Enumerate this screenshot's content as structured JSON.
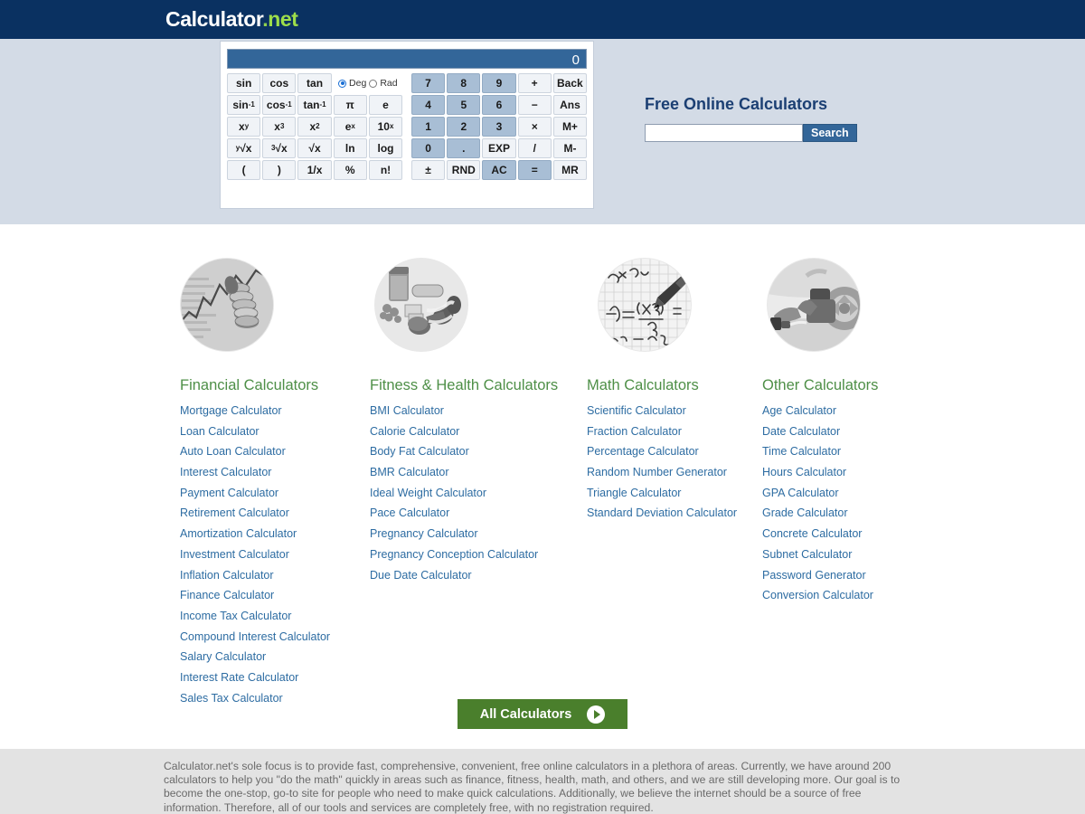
{
  "header": {
    "logo_word": "Calculator",
    "logo_dot": ".",
    "logo_tld": "net",
    "bg_color": "#0a3161"
  },
  "hero": {
    "bg_color": "#d3dbe6",
    "title": "Free Online Calculators",
    "search": {
      "value": "",
      "placeholder": "",
      "button_label": "Search"
    }
  },
  "calculator": {
    "display_value": "0",
    "angle_mode": {
      "selected": "Deg",
      "options": [
        "Deg",
        "Rad"
      ]
    },
    "rows": [
      {
        "left": [
          "sin",
          "cos",
          "tan"
        ],
        "mode_widget": true,
        "right": [
          "7",
          "8",
          "9",
          "+",
          "Back"
        ]
      },
      {
        "left": [
          "sin⁻¹",
          "cos⁻¹",
          "tan⁻¹",
          "π",
          "e"
        ],
        "right": [
          "4",
          "5",
          "6",
          "−",
          "Ans"
        ]
      },
      {
        "left": [
          "xʸ",
          "x³",
          "x²",
          "eˣ",
          "10ˣ"
        ],
        "right": [
          "1",
          "2",
          "3",
          "×",
          "M+"
        ]
      },
      {
        "left": [
          "ʸ√x",
          "³√x",
          "√x",
          "ln",
          "log"
        ],
        "right": [
          "0",
          ".",
          "EXP",
          "/",
          "M-"
        ]
      },
      {
        "left": [
          "(",
          ")",
          "1/x",
          "%",
          "n!"
        ],
        "right": [
          "±",
          "RND",
          "AC",
          "=",
          "MR"
        ]
      }
    ],
    "accent_keys": [
      "7",
      "8",
      "9",
      "4",
      "5",
      "6",
      "1",
      "2",
      "3",
      "0",
      ".",
      "AC",
      "="
    ],
    "display_bg": "#336699",
    "key_bg": "#f0f3f7",
    "key_accent_bg": "#a8bed5"
  },
  "categories": [
    {
      "thumb_icon": "coins-chart-icon",
      "title": "Financial Calculators",
      "links": [
        "Mortgage Calculator",
        "Loan Calculator",
        "Auto Loan Calculator",
        "Interest Calculator",
        "Payment Calculator",
        "Retirement Calculator",
        "Amortization Calculator",
        "Investment Calculator",
        "Inflation Calculator",
        "Finance Calculator",
        "Income Tax Calculator",
        "Compound Interest Calculator",
        "Salary Calculator",
        "Interest Rate Calculator",
        "Sales Tax Calculator"
      ]
    },
    {
      "thumb_icon": "food-dumbbell-icon",
      "title": "Fitness & Health Calculators",
      "links": [
        "BMI Calculator",
        "Calorie Calculator",
        "Body Fat Calculator",
        "BMR Calculator",
        "Ideal Weight Calculator",
        "Pace Calculator",
        "Pregnancy Calculator",
        "Pregnancy Conception Calculator",
        "Due Date Calculator"
      ]
    },
    {
      "thumb_icon": "pencil-equation-icon",
      "title": "Math Calculators",
      "links": [
        "Scientific Calculator",
        "Fraction Calculator",
        "Percentage Calculator",
        "Random Number Generator",
        "Triangle Calculator",
        "Standard Deviation Calculator"
      ]
    },
    {
      "thumb_icon": "fuel-pump-icon",
      "title": "Other Calculators",
      "links": [
        "Age Calculator",
        "Date Calculator",
        "Time Calculator",
        "Hours Calculator",
        "GPA Calculator",
        "Grade Calculator",
        "Concrete Calculator",
        "Subnet Calculator",
        "Password Generator",
        "Conversion Calculator"
      ]
    }
  ],
  "all_calculators": {
    "label": "All Calculators",
    "icon": "play-arrow-icon",
    "bg_color": "#4a7f2c"
  },
  "footer": {
    "text": "Calculator.net's sole focus is to provide fast, comprehensive, convenient, free online calculators in a plethora of areas. Currently, we have around 200 calculators to help you \"do the math\" quickly in areas such as finance, fitness, health, math, and others, and we are still developing more. Our goal is to become the one-stop, go-to site for people who need to make quick calculations. Additionally, we believe the internet should be a source of free information. Therefore, all of our tools and services are completely free, with no registration required.",
    "bg_color": "#e3e3e3"
  }
}
